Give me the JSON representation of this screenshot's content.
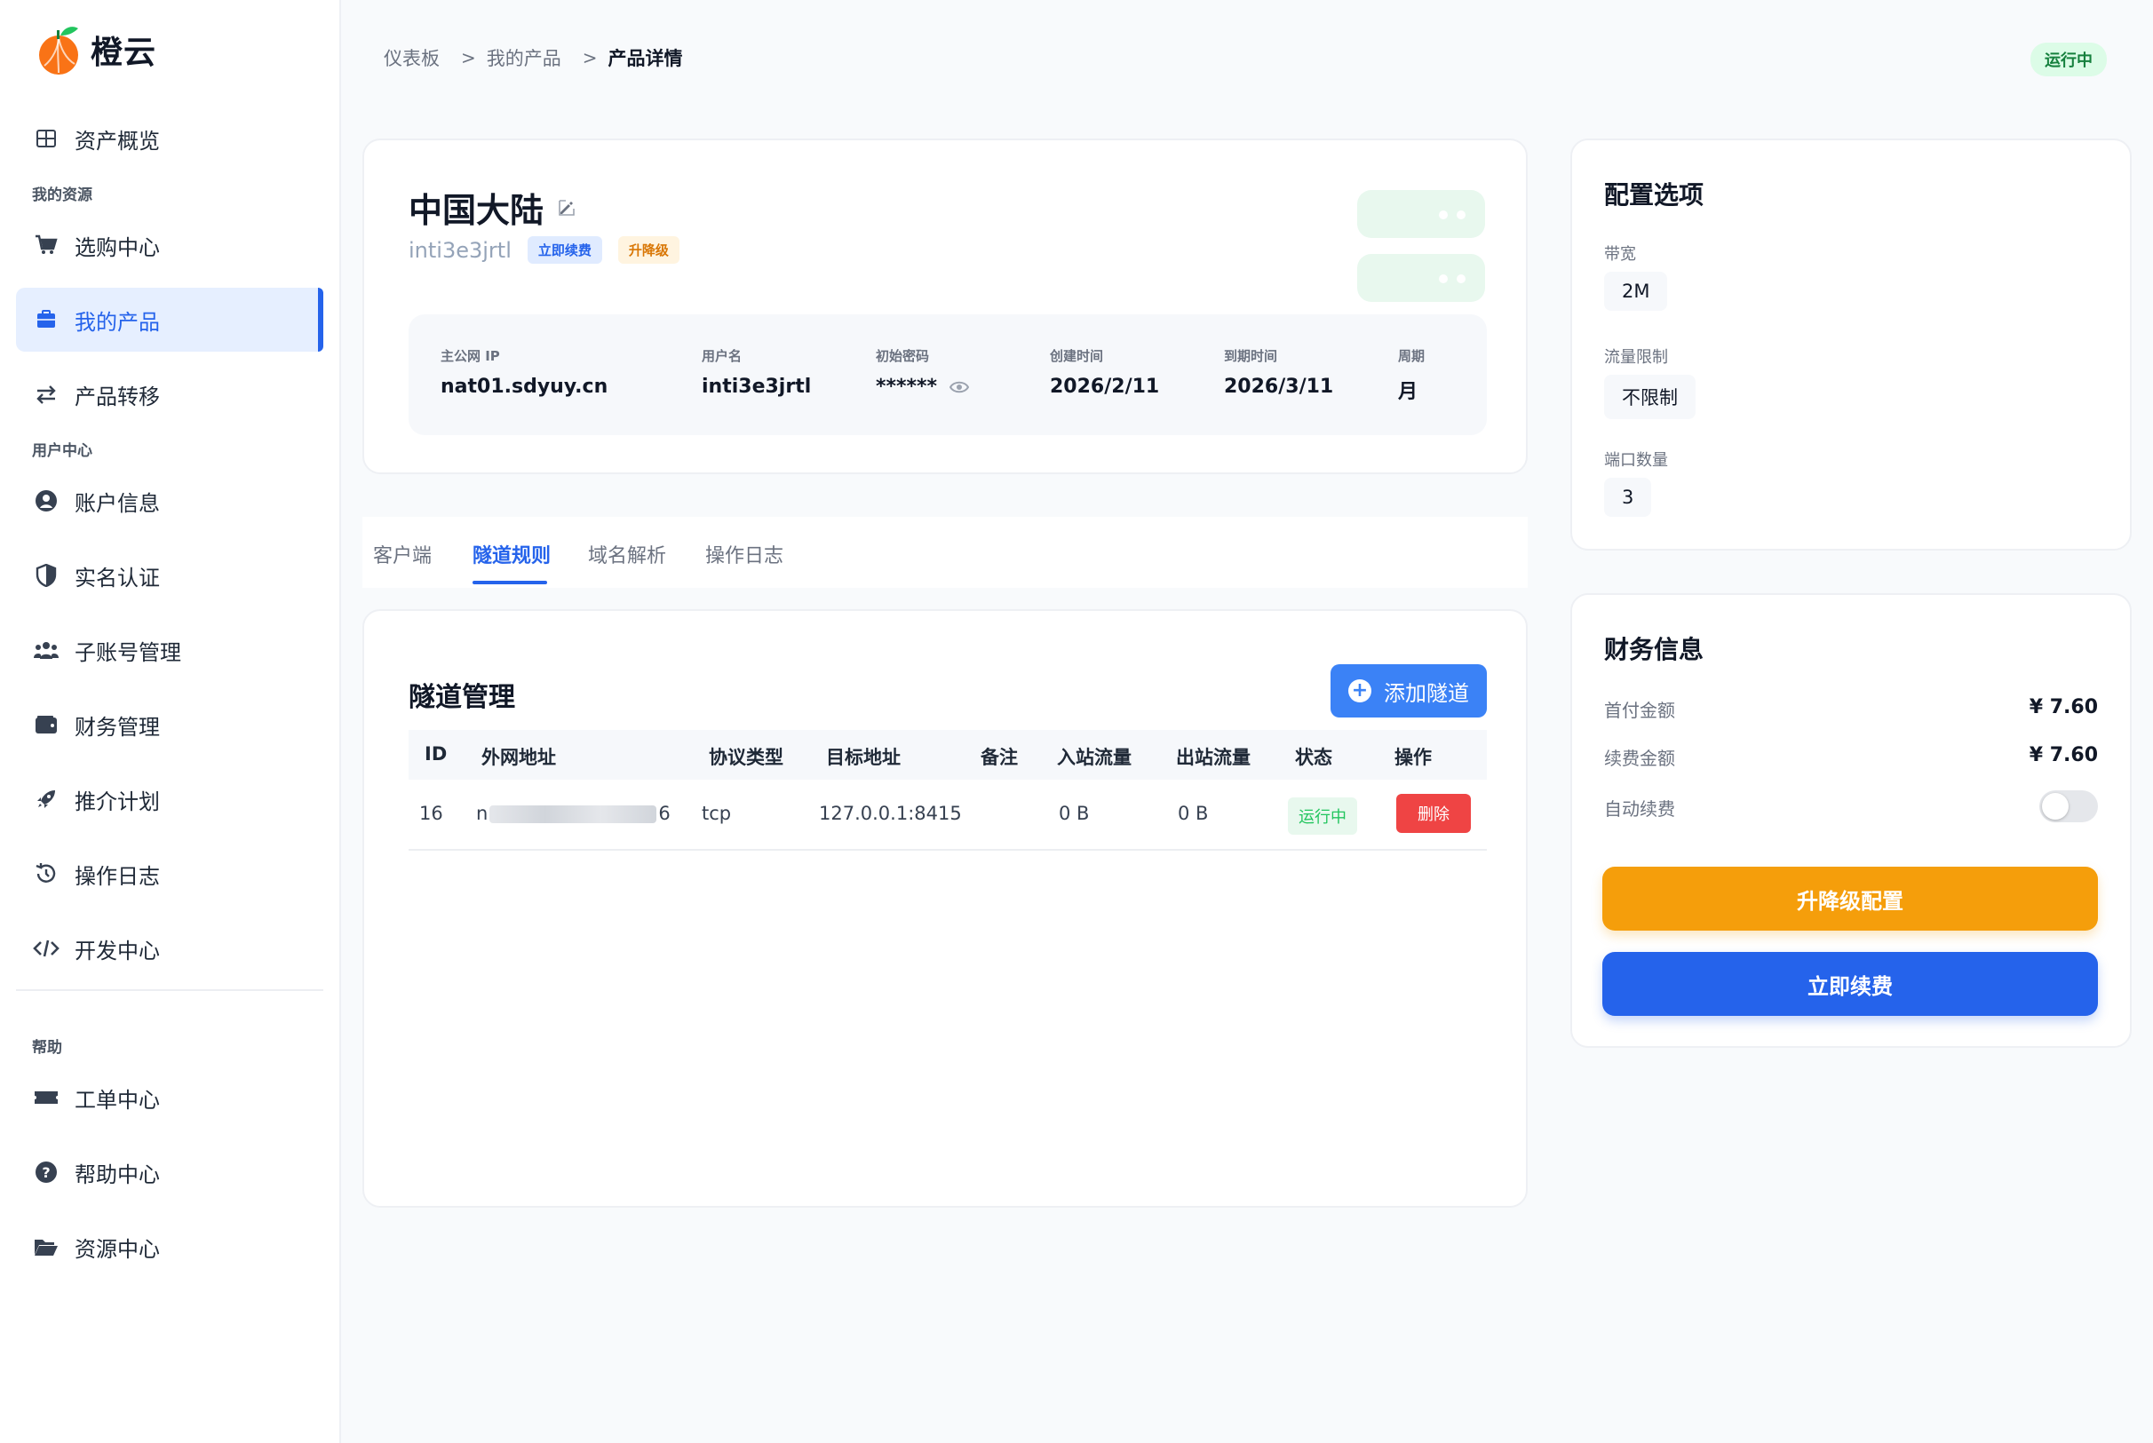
{
  "brand": {
    "name": "橙云"
  },
  "sidebar": {
    "overview": "资产概览",
    "section_resources": "我的资源",
    "shop": "选购中心",
    "my_products": "我的产品",
    "transfer": "产品转移",
    "section_user": "用户中心",
    "account": "账户信息",
    "verify": "实名认证",
    "subaccount": "子账号管理",
    "finance": "财务管理",
    "referral": "推介计划",
    "oplog": "操作日志",
    "dev": "开发中心",
    "section_help": "帮助",
    "ticket": "工单中心",
    "help": "帮助中心",
    "resources": "资源中心"
  },
  "breadcrumb": {
    "b1": "仪表板",
    "b2": "我的产品",
    "b3": "产品详情",
    "sep": ">"
  },
  "top_status": "运行中",
  "product": {
    "title": "中国大陆",
    "username_sub": "inti3e3jrtl",
    "tag_renew": "立即续费",
    "tag_upgrade": "升降级",
    "info": {
      "ip_label": "主公网 IP",
      "ip_value": "nat01.sdyuy.cn",
      "user_label": "用户名",
      "user_value": "inti3e3jrtl",
      "pwd_label": "初始密码",
      "pwd_value": "******",
      "created_label": "创建时间",
      "created_value": "2026/2/11",
      "expire_label": "到期时间",
      "expire_value": "2026/3/11",
      "period_label": "周期",
      "period_value": "月"
    }
  },
  "tabs": {
    "t1": "客户端",
    "t2": "隧道规则",
    "t3": "域名解析",
    "t4": "操作日志"
  },
  "tunnel": {
    "title": "隧道管理",
    "add_button": "添加隧道",
    "headers": {
      "id": "ID",
      "ext": "外网地址",
      "proto": "协议类型",
      "target": "目标地址",
      "note": "备注",
      "in": "入站流量",
      "out": "出站流量",
      "status": "状态",
      "action": "操作"
    },
    "row": {
      "id": "16",
      "ext_start": "n",
      "ext_end": "6",
      "proto": "tcp",
      "target": "127.0.0.1:8415",
      "in": "0 B",
      "out": "0 B",
      "status": "运行中",
      "delete": "删除"
    }
  },
  "config": {
    "title": "配置选项",
    "bandwidth_label": "带宽",
    "bandwidth_value": "2M",
    "traffic_label": "流量限制",
    "traffic_value": "不限制",
    "ports_label": "端口数量",
    "ports_value": "3"
  },
  "finance": {
    "title": "财务信息",
    "first_label": "首付金额",
    "first_value": "¥ 7.60",
    "renew_label": "续费金额",
    "renew_value": "¥ 7.60",
    "auto_label": "自动续费",
    "upgrade_button": "升降级配置",
    "renew_button": "立即续费"
  },
  "colors": {
    "primary": "#2563eb",
    "accent_orange": "#f59e0b",
    "danger": "#ef4444",
    "success": "#22c55e"
  }
}
